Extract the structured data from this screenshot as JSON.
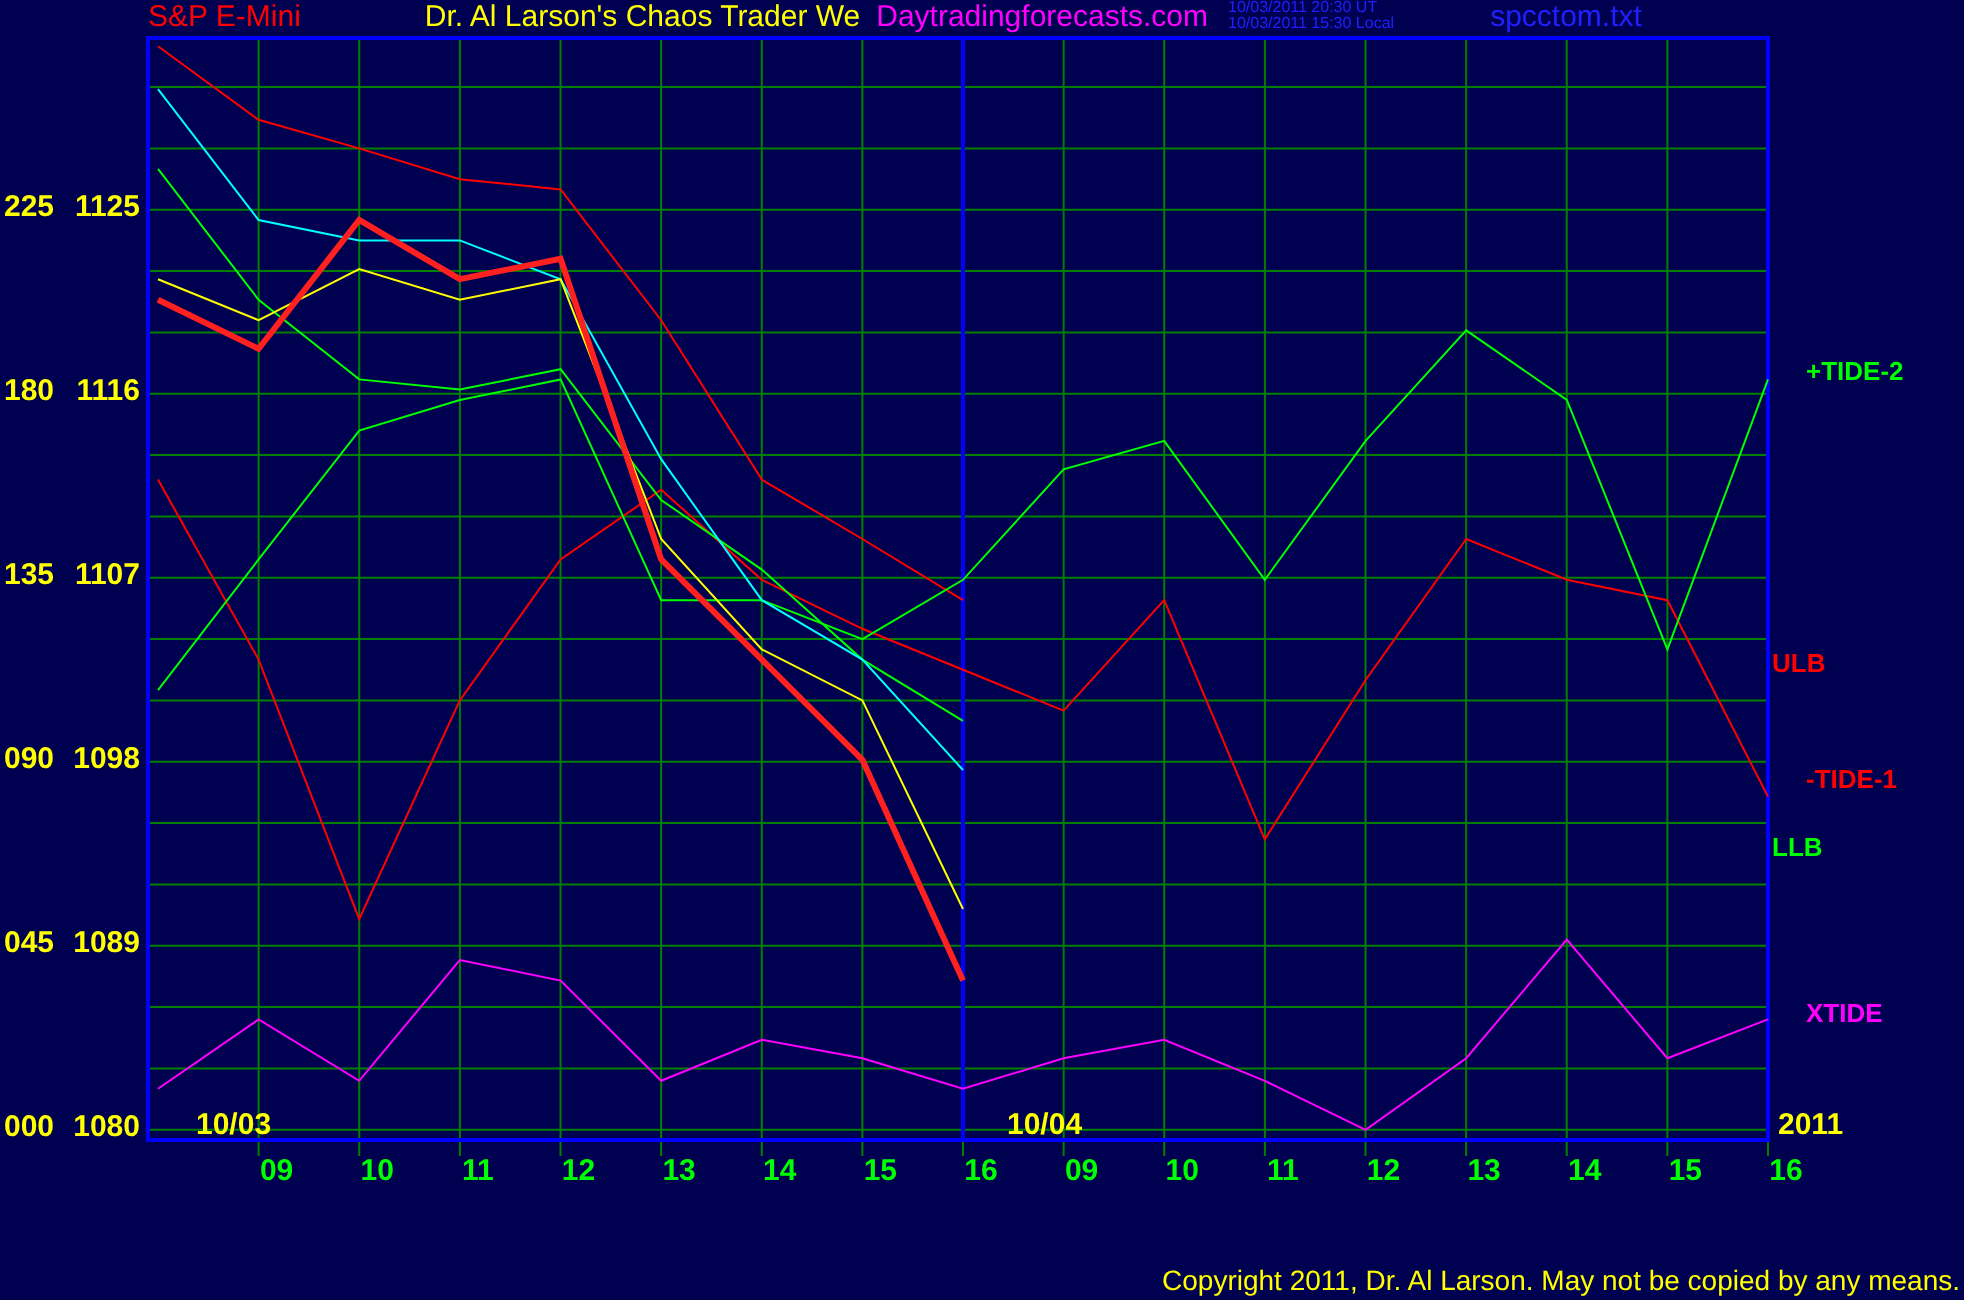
{
  "header": {
    "symbol": "S&P E-Mini",
    "site_title": "Dr. Al Larson's Chaos Trader We",
    "site_url": "Daytradingforecasts.com",
    "timestamps": [
      "10/03/2011 20:30 UT",
      "10/03/2011 15:30 Local"
    ],
    "file_name": "spcctom.txt"
  },
  "chart": {
    "chart_data": {
      "type": "line",
      "categories": [
        null,
        "09",
        "10",
        "11",
        "12",
        "13",
        "14",
        "15",
        "16",
        "09",
        "10",
        "11",
        "12",
        "13",
        "14",
        "15",
        "16"
      ],
      "ylim": [
        1079.5,
        1133.5
      ],
      "grid": true,
      "ref_lines": [
        {
          "axis": "x",
          "value": "16",
          "color": "#0000ff"
        }
      ],
      "yticks": [
        1125,
        1116,
        1107,
        1098,
        1089,
        1080
      ],
      "series": [
        {
          "color": "#ff0000",
          "values": [
            1133,
            1129.4,
            1128,
            1126.5,
            1126,
            1119.6,
            1111.8,
            1108.9,
            1105.9,
            null,
            null,
            null,
            null,
            null,
            null,
            null,
            null
          ]
        },
        {
          "name": "-TIDE-1",
          "color": "#ff0000",
          "values": [
            1111.8,
            1103,
            1090.3,
            1101,
            1107.9,
            1111.3,
            1106.9,
            1104.5,
            1102.5,
            1100.5,
            1105.9,
            1094.2,
            1102,
            1108.9,
            1106.9,
            1105.9,
            1096.3
          ]
        },
        {
          "name": "+TIDE-2",
          "color": "#00ff00",
          "values": [
            1101.5,
            1107.9,
            1114.2,
            1115.7,
            1116.7,
            1105.9,
            1105.9,
            1104,
            1106.9,
            1112.3,
            1113.7,
            1106.9,
            1113.7,
            1119.1,
            1115.7,
            1103.5,
            1116.7
          ]
        },
        {
          "color": "#00ff00",
          "values": [
            1127,
            1120.6,
            1116.7,
            1116.2,
            1117.2,
            1110.8,
            1107.4,
            1103,
            1100,
            null,
            null,
            null,
            null,
            null,
            null,
            null,
            null
          ]
        },
        {
          "color": "#00ffff",
          "values": [
            1130.9,
            1124.5,
            1123.5,
            1123.5,
            1121.6,
            1112.8,
            1105.9,
            1103,
            1097.6,
            null,
            null,
            null,
            null,
            null,
            null,
            null,
            null
          ]
        },
        {
          "color": "#ffff00",
          "values": [
            1121.6,
            1119.6,
            1122.1,
            1120.6,
            1121.6,
            1108.9,
            1103.5,
            1101,
            1090.8,
            null,
            null,
            null,
            null,
            null,
            null,
            null,
            null
          ]
        },
        {
          "color": "#ff2020",
          "values": [
            1120.6,
            1118.2,
            1124.5,
            1121.6,
            1122.6,
            1107.9,
            1103,
            1098.1,
            1087.3,
            null,
            null,
            null,
            null,
            null,
            null,
            null,
            null
          ]
        },
        {
          "name": "XTIDE",
          "color": "#ff00ff",
          "values": [
            1082,
            1085.4,
            1082.4,
            1088.3,
            1087.3,
            1082.4,
            1084.4,
            1083.5,
            1082,
            1083.5,
            1084.4,
            1082.4,
            1080,
            1083.5,
            1089.3,
            1083.5,
            1085.4
          ]
        }
      ]
    },
    "secondary_scale": [
      "225",
      "180",
      "135",
      "090",
      "045",
      "000"
    ],
    "side_labels": [
      {
        "text": "ULB",
        "color": "#ff0000"
      },
      {
        "text": "LLB",
        "color": "#00ff00"
      }
    ],
    "dates": [
      "10/03",
      "10/04"
    ],
    "year": "2011"
  },
  "copyright": "Copyright 2011, Dr. Al Larson. May not be copied by any means."
}
